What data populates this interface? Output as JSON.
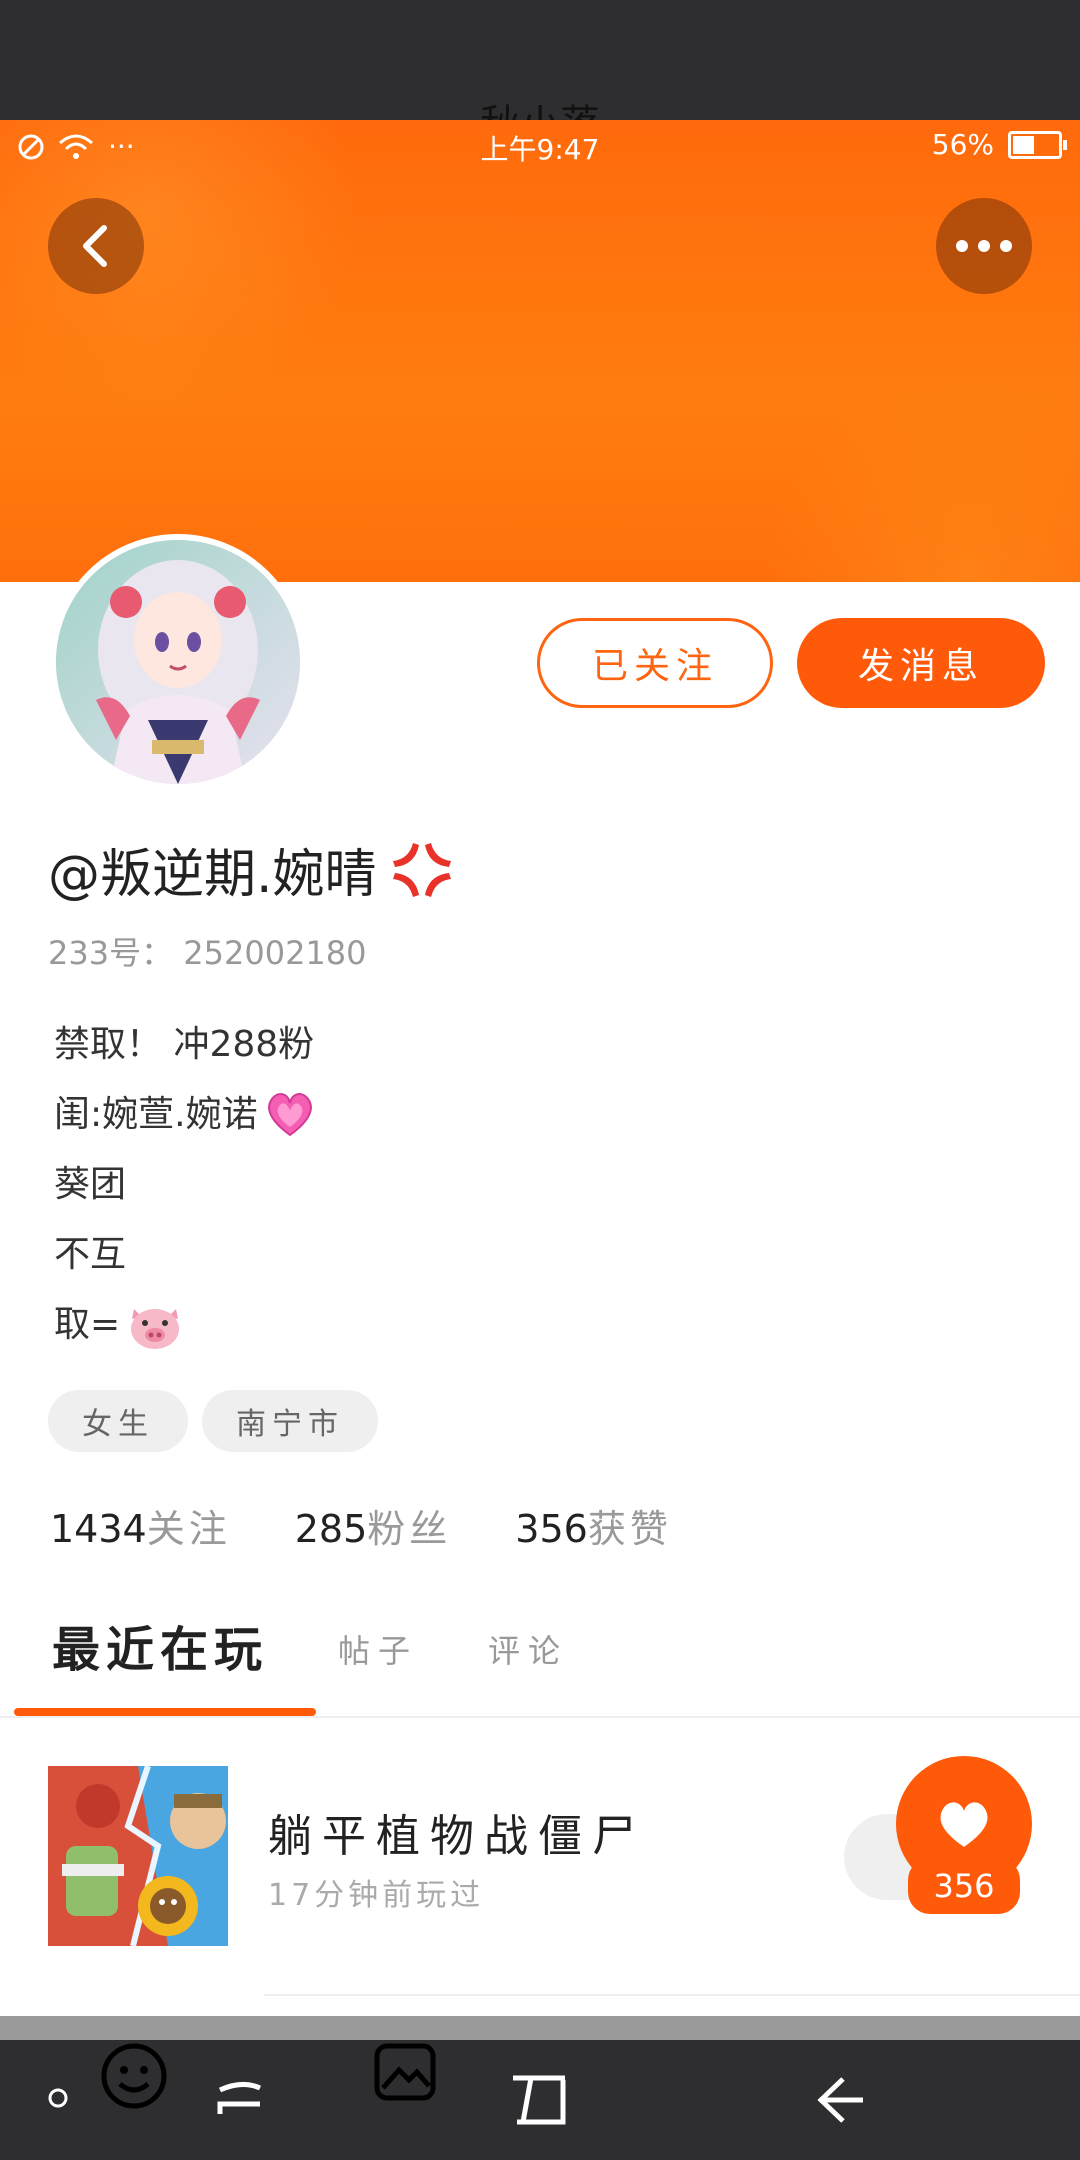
{
  "header": {
    "ghost_title": "秋小落"
  },
  "status_bar": {
    "time": "上午9:47",
    "battery": "56%",
    "battery_level": 0.56,
    "dots": "···"
  },
  "profile": {
    "followed_label": "已关注",
    "message_label": "发消息",
    "username": "@叛逆期.婉晴",
    "uid_label": "233号：",
    "uid": "252002180",
    "bio": [
      "禁取！ 冲288粉",
      "闺:婉萱.婉诺",
      "葵团",
      "不互",
      "取="
    ],
    "tags": [
      "女生",
      "南宁市"
    ],
    "stats": [
      {
        "value": "1434",
        "label": "关注"
      },
      {
        "value": "285",
        "label": "粉丝"
      },
      {
        "value": "356",
        "label": "获赞"
      }
    ]
  },
  "tabs": {
    "active": "最近在玩",
    "items": [
      "帖子",
      "评论"
    ]
  },
  "games": [
    {
      "name": "躺平植物战僵尸",
      "last_played": "17分钟前玩过"
    }
  ],
  "like": {
    "count": "356"
  },
  "icons": {
    "back": "chevron-left-icon",
    "more": "more-dots-icon",
    "like": "heart-icon",
    "angry": "anger-emoji-icon",
    "heart_emoji": "pink-heart-emoji-icon",
    "pig": "pig-face-emoji-icon"
  },
  "colors": {
    "accent": "#ff5a0a",
    "banner": "#ff7a10",
    "muted_text": "#999999"
  }
}
